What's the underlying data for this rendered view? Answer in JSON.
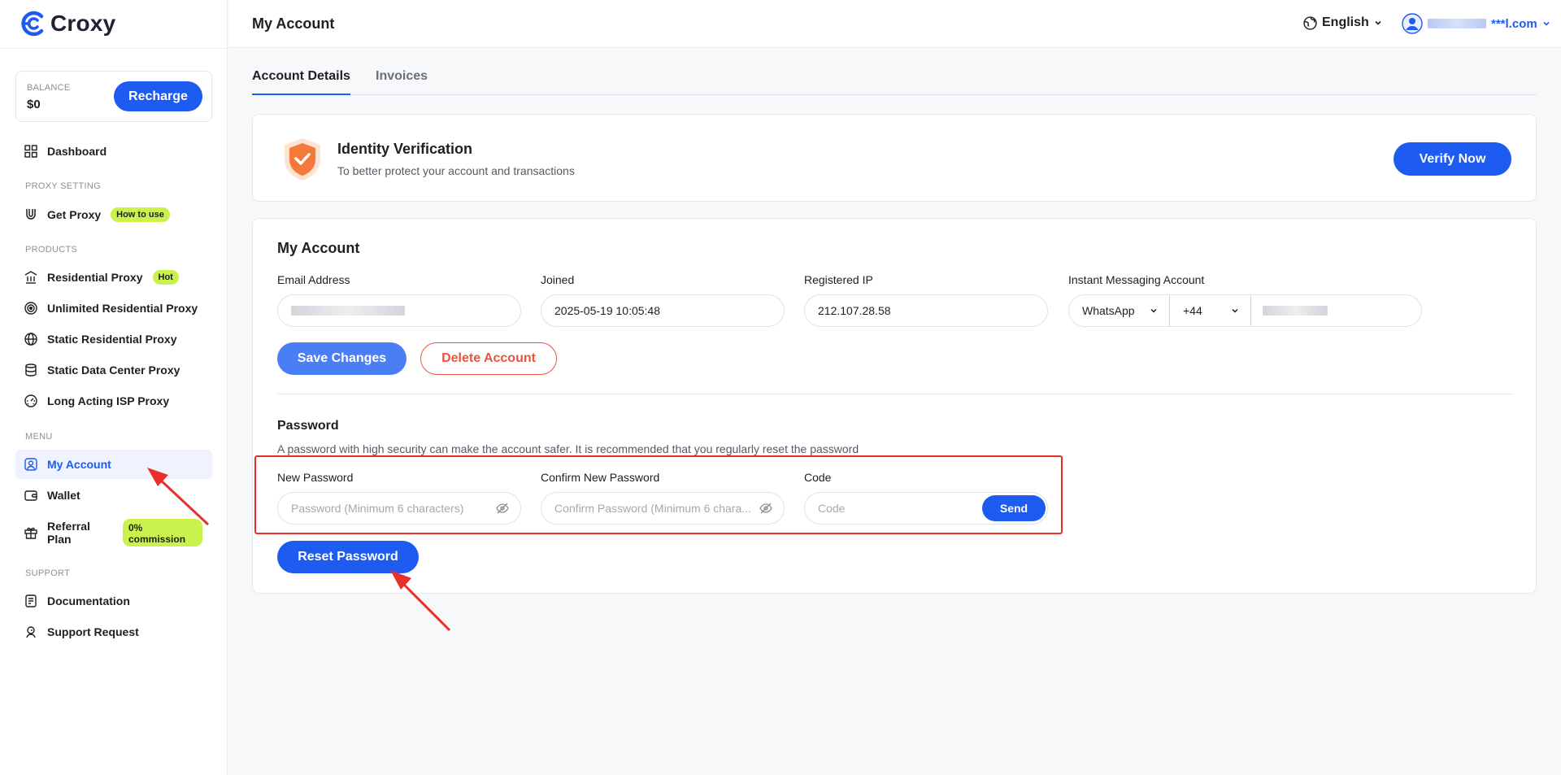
{
  "brand": {
    "name": "Croxy",
    "accent": "#1e5bf0",
    "lime": "#c9f24d"
  },
  "balance": {
    "label": "BALANCE",
    "value": "$0",
    "recharge_label": "Recharge"
  },
  "sidebar": {
    "dashboard": "Dashboard",
    "proxy_setting_label": "PROXY SETTING",
    "get_proxy": "Get Proxy",
    "how_to_use": "How to use",
    "products_label": "PRODUCTS",
    "residential": "Residential Proxy",
    "hot": "Hot",
    "unlimited": "Unlimited Residential Proxy",
    "static_residential": "Static Residential Proxy",
    "static_dc": "Static Data Center Proxy",
    "long_isp": "Long Acting ISP Proxy",
    "menu_label": "MENU",
    "my_account": "My Account",
    "wallet": "Wallet",
    "referral_line1": "Referral",
    "referral_line2": "Plan",
    "commission": "0% commission",
    "support_label": "SUPPORT",
    "documentation": "Documentation",
    "support_request": "Support Request"
  },
  "header": {
    "title": "My Account",
    "language": "English",
    "user_email_suffix": "***l.com"
  },
  "tabs": {
    "account_details": "Account Details",
    "invoices": "Invoices"
  },
  "verify": {
    "title": "Identity Verification",
    "subtitle": "To better protect your account and transactions",
    "button": "Verify Now"
  },
  "account": {
    "title": "My Account",
    "email_label": "Email Address",
    "joined_label": "Joined",
    "joined_value": "2025-05-19 10:05:48",
    "ip_label": "Registered IP",
    "ip_value": "212.107.28.58",
    "im_label": "Instant Messaging Account",
    "im_app": "WhatsApp",
    "im_code": "+44",
    "save_label": "Save Changes",
    "delete_label": "Delete Account"
  },
  "password": {
    "title": "Password",
    "description": "A password with high security can make the account safer. It is recommended that you regularly reset the password",
    "new_label": "New Password",
    "new_placeholder": "Password (Minimum 6 characters)",
    "confirm_label": "Confirm New Password",
    "confirm_placeholder": "Confirm Password (Minimum 6 chara...",
    "code_label": "Code",
    "code_placeholder": "Code",
    "send_label": "Send",
    "reset_label": "Reset Password"
  }
}
